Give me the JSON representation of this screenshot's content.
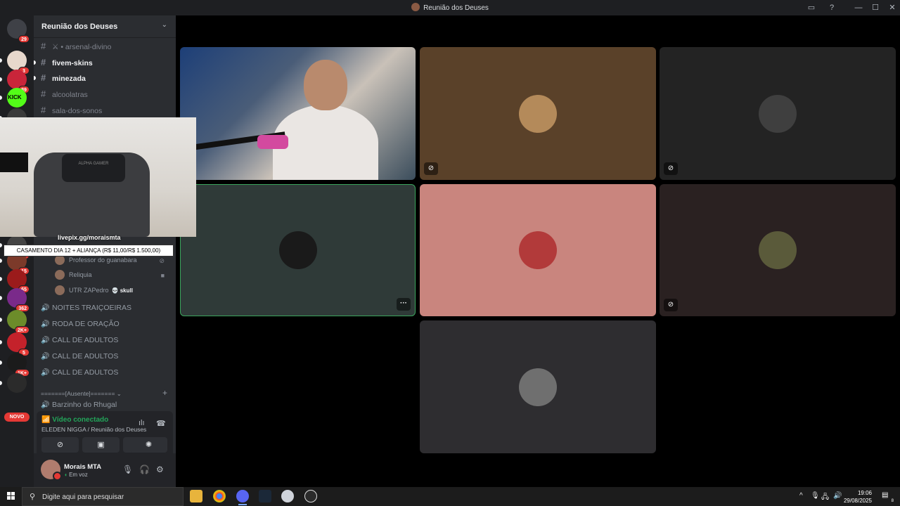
{
  "window": {
    "title": "Reunião dos Deuses"
  },
  "rail": {
    "badges": [
      "29",
      "3",
      "89",
      "",
      "",
      "",
      "",
      "",
      "",
      "",
      "",
      "4",
      "15",
      "65",
      "362",
      "2K+",
      "5",
      "1K+",
      ""
    ],
    "kick_label": "KICK",
    "novo_label": "NOVO"
  },
  "sidebar": {
    "server_name": "Reunião dos Deuses",
    "text_channels": [
      {
        "name": "⚔ • arsenal-divino",
        "unread": false
      },
      {
        "name": "fivem-skins",
        "unread": true
      },
      {
        "name": "minezada",
        "unread": true
      },
      {
        "name": "alcoolatras",
        "unread": false
      },
      {
        "name": "sala-dos-sonos",
        "unread": false
      }
    ],
    "members": [
      {
        "name": "Professor do guanabara",
        "tag": ""
      },
      {
        "name": "Reliquia",
        "tag": ""
      },
      {
        "name": "UTR ZAPedro",
        "tag": "💀 skull"
      }
    ],
    "voice_channels": [
      "NOITES TRAIÇOEIRAS",
      "RODA DE ORAÇÃO",
      "CALL DE ADULTOS",
      "CALL DE ADULTOS",
      "CALL DE ADULTOS"
    ],
    "category": "=======[Ausente]=======  ⌄",
    "last_channel": "Barzinho do Rhugal"
  },
  "voice_panel": {
    "status": "Vídeo conectado",
    "location": "ELEDEN NIGGA / Reunião dos Deuses"
  },
  "user_panel": {
    "name": "Morais MTA",
    "status": "Em voz"
  },
  "overlay": {
    "pip_chair_text": "ALPHA GAMER",
    "donation_link": "livepix.gg/moraismta",
    "donation_banner": "CASAMENTO DIA 12 + ALIANÇA (R$ 11,00/R$ 1.500,00)"
  },
  "tiles": [
    {
      "bg": "#5a4129",
      "avatar": "#b48a5a",
      "corner": "camera-off",
      "more": false
    },
    {
      "bg": "#232323",
      "avatar": "#3f3f3f",
      "corner": "camera-off",
      "more": false
    },
    {
      "bg": "#2f3a38",
      "avatar": "#1a1a1a",
      "corner": "",
      "more": true
    },
    {
      "bg": "#c9857e",
      "avatar": "#b23a3a",
      "corner": "",
      "more": false
    },
    {
      "bg": "#2a2121",
      "avatar": "#5a5a3a",
      "corner": "mic-off",
      "more": false
    },
    {
      "bg": "#2e2d30",
      "avatar": "#6f6f6f",
      "corner": "",
      "more": false
    }
  ],
  "taskbar": {
    "search_placeholder": "Digite aqui para pesquisar",
    "time": "19:06",
    "date": "29/08/2025",
    "notification_count": "8"
  }
}
